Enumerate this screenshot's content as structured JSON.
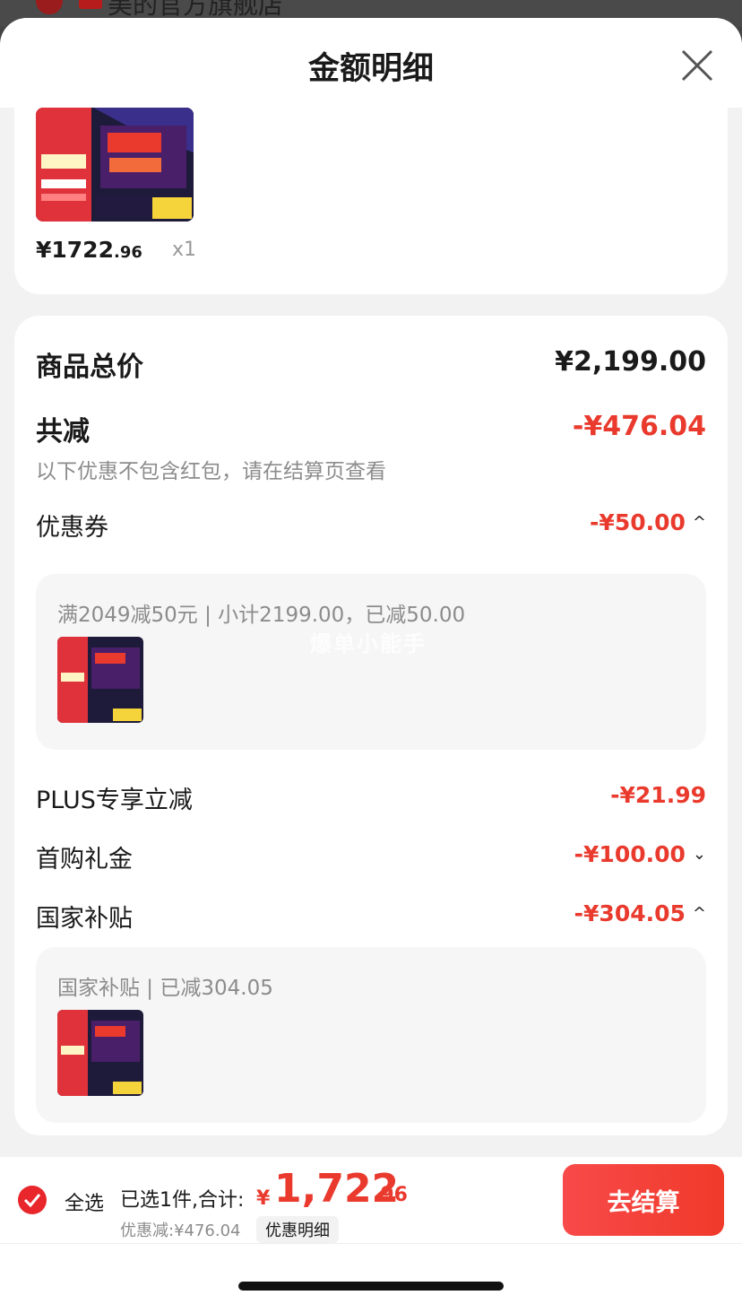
{
  "background": {
    "store_name": "美的官方旗舰店"
  },
  "sheet": {
    "title": "金额明细"
  },
  "product": {
    "price_int": "¥1722",
    "price_dec": ".96",
    "quantity": "x1"
  },
  "summary": {
    "total_label": "商品总价",
    "total_value": "¥2,199.00",
    "discount_label": "共减",
    "discount_value": "-¥476.04",
    "discount_note": "以下优惠不包含红包，请在结算页查看"
  },
  "coupon": {
    "label": "优惠券",
    "value": "-¥50.00",
    "detail": "满2049减50元 | 小计2199.00，已减50.00",
    "watermark": "爆单小能手"
  },
  "plus": {
    "label": "PLUS专享立减",
    "value": "-¥21.99"
  },
  "first_gift": {
    "label": "首购礼金",
    "value": "-¥100.00"
  },
  "subsidy": {
    "label": "国家补贴",
    "value": "-¥304.05",
    "detail": "国家补贴 | 已减304.05"
  },
  "bottom": {
    "select_all": "全选",
    "selected_total_label": "已选1件,合计:",
    "currency": "¥",
    "total_int": "1,722",
    "total_dec": ".96",
    "saving": "优惠减:¥476.04",
    "detail_chip": "优惠明细",
    "checkout": "去结算"
  },
  "colors": {
    "accent_red": "#e93a2d",
    "check_red": "#e8262b"
  }
}
